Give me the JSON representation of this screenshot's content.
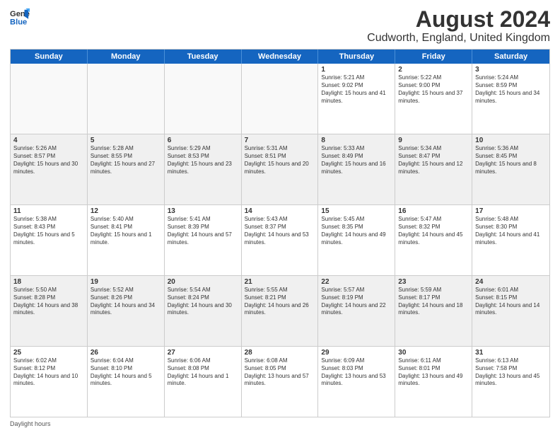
{
  "header": {
    "logo_general": "General",
    "logo_blue": "Blue",
    "title": "August 2024",
    "subtitle": "Cudworth, England, United Kingdom"
  },
  "weekdays": [
    "Sunday",
    "Monday",
    "Tuesday",
    "Wednesday",
    "Thursday",
    "Friday",
    "Saturday"
  ],
  "rows": [
    [
      {
        "day": "",
        "sunrise": "",
        "sunset": "",
        "daylight": "",
        "empty": true
      },
      {
        "day": "",
        "sunrise": "",
        "sunset": "",
        "daylight": "",
        "empty": true
      },
      {
        "day": "",
        "sunrise": "",
        "sunset": "",
        "daylight": "",
        "empty": true
      },
      {
        "day": "",
        "sunrise": "",
        "sunset": "",
        "daylight": "",
        "empty": true
      },
      {
        "day": "1",
        "sunrise": "Sunrise: 5:21 AM",
        "sunset": "Sunset: 9:02 PM",
        "daylight": "Daylight: 15 hours and 41 minutes."
      },
      {
        "day": "2",
        "sunrise": "Sunrise: 5:22 AM",
        "sunset": "Sunset: 9:00 PM",
        "daylight": "Daylight: 15 hours and 37 minutes."
      },
      {
        "day": "3",
        "sunrise": "Sunrise: 5:24 AM",
        "sunset": "Sunset: 8:59 PM",
        "daylight": "Daylight: 15 hours and 34 minutes."
      }
    ],
    [
      {
        "day": "4",
        "sunrise": "Sunrise: 5:26 AM",
        "sunset": "Sunset: 8:57 PM",
        "daylight": "Daylight: 15 hours and 30 minutes."
      },
      {
        "day": "5",
        "sunrise": "Sunrise: 5:28 AM",
        "sunset": "Sunset: 8:55 PM",
        "daylight": "Daylight: 15 hours and 27 minutes."
      },
      {
        "day": "6",
        "sunrise": "Sunrise: 5:29 AM",
        "sunset": "Sunset: 8:53 PM",
        "daylight": "Daylight: 15 hours and 23 minutes."
      },
      {
        "day": "7",
        "sunrise": "Sunrise: 5:31 AM",
        "sunset": "Sunset: 8:51 PM",
        "daylight": "Daylight: 15 hours and 20 minutes."
      },
      {
        "day": "8",
        "sunrise": "Sunrise: 5:33 AM",
        "sunset": "Sunset: 8:49 PM",
        "daylight": "Daylight: 15 hours and 16 minutes."
      },
      {
        "day": "9",
        "sunrise": "Sunrise: 5:34 AM",
        "sunset": "Sunset: 8:47 PM",
        "daylight": "Daylight: 15 hours and 12 minutes."
      },
      {
        "day": "10",
        "sunrise": "Sunrise: 5:36 AM",
        "sunset": "Sunset: 8:45 PM",
        "daylight": "Daylight: 15 hours and 8 minutes."
      }
    ],
    [
      {
        "day": "11",
        "sunrise": "Sunrise: 5:38 AM",
        "sunset": "Sunset: 8:43 PM",
        "daylight": "Daylight: 15 hours and 5 minutes."
      },
      {
        "day": "12",
        "sunrise": "Sunrise: 5:40 AM",
        "sunset": "Sunset: 8:41 PM",
        "daylight": "Daylight: 15 hours and 1 minute."
      },
      {
        "day": "13",
        "sunrise": "Sunrise: 5:41 AM",
        "sunset": "Sunset: 8:39 PM",
        "daylight": "Daylight: 14 hours and 57 minutes."
      },
      {
        "day": "14",
        "sunrise": "Sunrise: 5:43 AM",
        "sunset": "Sunset: 8:37 PM",
        "daylight": "Daylight: 14 hours and 53 minutes."
      },
      {
        "day": "15",
        "sunrise": "Sunrise: 5:45 AM",
        "sunset": "Sunset: 8:35 PM",
        "daylight": "Daylight: 14 hours and 49 minutes."
      },
      {
        "day": "16",
        "sunrise": "Sunrise: 5:47 AM",
        "sunset": "Sunset: 8:32 PM",
        "daylight": "Daylight: 14 hours and 45 minutes."
      },
      {
        "day": "17",
        "sunrise": "Sunrise: 5:48 AM",
        "sunset": "Sunset: 8:30 PM",
        "daylight": "Daylight: 14 hours and 41 minutes."
      }
    ],
    [
      {
        "day": "18",
        "sunrise": "Sunrise: 5:50 AM",
        "sunset": "Sunset: 8:28 PM",
        "daylight": "Daylight: 14 hours and 38 minutes."
      },
      {
        "day": "19",
        "sunrise": "Sunrise: 5:52 AM",
        "sunset": "Sunset: 8:26 PM",
        "daylight": "Daylight: 14 hours and 34 minutes."
      },
      {
        "day": "20",
        "sunrise": "Sunrise: 5:54 AM",
        "sunset": "Sunset: 8:24 PM",
        "daylight": "Daylight: 14 hours and 30 minutes."
      },
      {
        "day": "21",
        "sunrise": "Sunrise: 5:55 AM",
        "sunset": "Sunset: 8:21 PM",
        "daylight": "Daylight: 14 hours and 26 minutes."
      },
      {
        "day": "22",
        "sunrise": "Sunrise: 5:57 AM",
        "sunset": "Sunset: 8:19 PM",
        "daylight": "Daylight: 14 hours and 22 minutes."
      },
      {
        "day": "23",
        "sunrise": "Sunrise: 5:59 AM",
        "sunset": "Sunset: 8:17 PM",
        "daylight": "Daylight: 14 hours and 18 minutes."
      },
      {
        "day": "24",
        "sunrise": "Sunrise: 6:01 AM",
        "sunset": "Sunset: 8:15 PM",
        "daylight": "Daylight: 14 hours and 14 minutes."
      }
    ],
    [
      {
        "day": "25",
        "sunrise": "Sunrise: 6:02 AM",
        "sunset": "Sunset: 8:12 PM",
        "daylight": "Daylight: 14 hours and 10 minutes."
      },
      {
        "day": "26",
        "sunrise": "Sunrise: 6:04 AM",
        "sunset": "Sunset: 8:10 PM",
        "daylight": "Daylight: 14 hours and 5 minutes."
      },
      {
        "day": "27",
        "sunrise": "Sunrise: 6:06 AM",
        "sunset": "Sunset: 8:08 PM",
        "daylight": "Daylight: 14 hours and 1 minute."
      },
      {
        "day": "28",
        "sunrise": "Sunrise: 6:08 AM",
        "sunset": "Sunset: 8:05 PM",
        "daylight": "Daylight: 13 hours and 57 minutes."
      },
      {
        "day": "29",
        "sunrise": "Sunrise: 6:09 AM",
        "sunset": "Sunset: 8:03 PM",
        "daylight": "Daylight: 13 hours and 53 minutes."
      },
      {
        "day": "30",
        "sunrise": "Sunrise: 6:11 AM",
        "sunset": "Sunset: 8:01 PM",
        "daylight": "Daylight: 13 hours and 49 minutes."
      },
      {
        "day": "31",
        "sunrise": "Sunrise: 6:13 AM",
        "sunset": "Sunset: 7:58 PM",
        "daylight": "Daylight: 13 hours and 45 minutes."
      }
    ]
  ],
  "footer": {
    "daylight_label": "Daylight hours"
  }
}
